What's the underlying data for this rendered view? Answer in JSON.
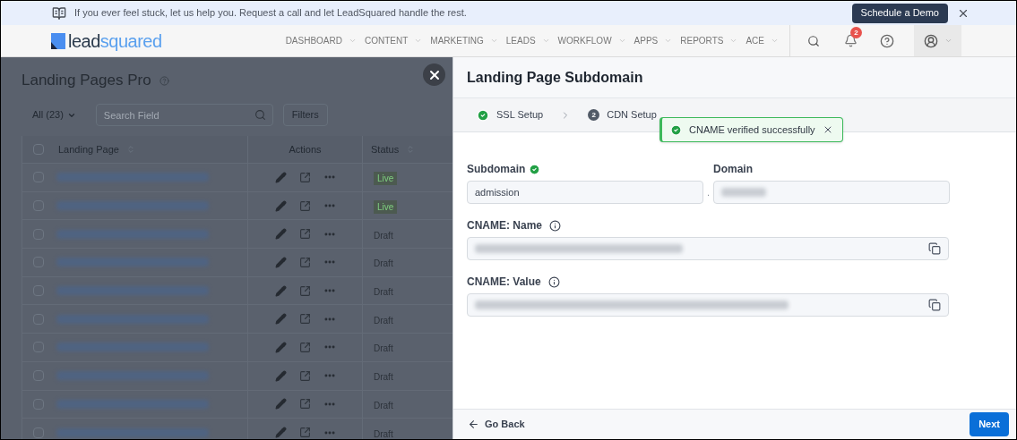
{
  "banner": {
    "message": "If you ever feel stuck, let us help you. Request a call and let LeadSquared handle the rest.",
    "demo_button": "Schedule a Demo"
  },
  "logo": {
    "dark_part": "lead",
    "accent_part": "squared"
  },
  "nav": {
    "items": [
      {
        "label": "DASHBOARD"
      },
      {
        "label": "CONTENT"
      },
      {
        "label": "MARKETING"
      },
      {
        "label": "LEADS"
      },
      {
        "label": "WORKFLOW"
      },
      {
        "label": "APPS"
      },
      {
        "label": "REPORTS"
      },
      {
        "label": "ACE"
      }
    ],
    "notification_count": "2"
  },
  "page": {
    "title": "Landing Pages Pro",
    "filter": "All (23)",
    "search": {
      "placeholder": "Search Field"
    },
    "filters_button": "Filters",
    "table": {
      "columns": [
        "Landing Page",
        "Actions",
        "Status"
      ],
      "select_all_checked": false,
      "rows": [
        {
          "status": "Live",
          "kind": "live",
          "checked": false
        },
        {
          "status": "Live",
          "kind": "live",
          "checked": false
        },
        {
          "status": "Draft",
          "kind": "draft",
          "checked": false
        },
        {
          "status": "Draft",
          "kind": "draft",
          "checked": false
        },
        {
          "status": "Draft",
          "kind": "draft",
          "checked": false
        },
        {
          "status": "Draft",
          "kind": "draft",
          "checked": false
        },
        {
          "status": "Draft",
          "kind": "draft",
          "checked": false
        },
        {
          "status": "Draft",
          "kind": "draft",
          "checked": false
        },
        {
          "status": "Draft",
          "kind": "draft",
          "checked": false
        },
        {
          "status": "Draft",
          "kind": "draft",
          "checked": false
        }
      ]
    }
  },
  "panel": {
    "title": "Landing Page Subdomain",
    "steps": [
      {
        "label": "SSL Setup",
        "kind": "done"
      },
      {
        "number": "2",
        "label": "CDN Setup",
        "kind": "current"
      }
    ],
    "toast": "CNAME verified successfully",
    "subdomain": {
      "label": "Subdomain",
      "value": "admission",
      "verified": true
    },
    "separator": ".",
    "domain": {
      "label": "Domain"
    },
    "cname_name": {
      "label": "CNAME: Name"
    },
    "cname_value": {
      "label": "CNAME: Value"
    },
    "back_button": "Go Back",
    "next_button": "Next"
  }
}
